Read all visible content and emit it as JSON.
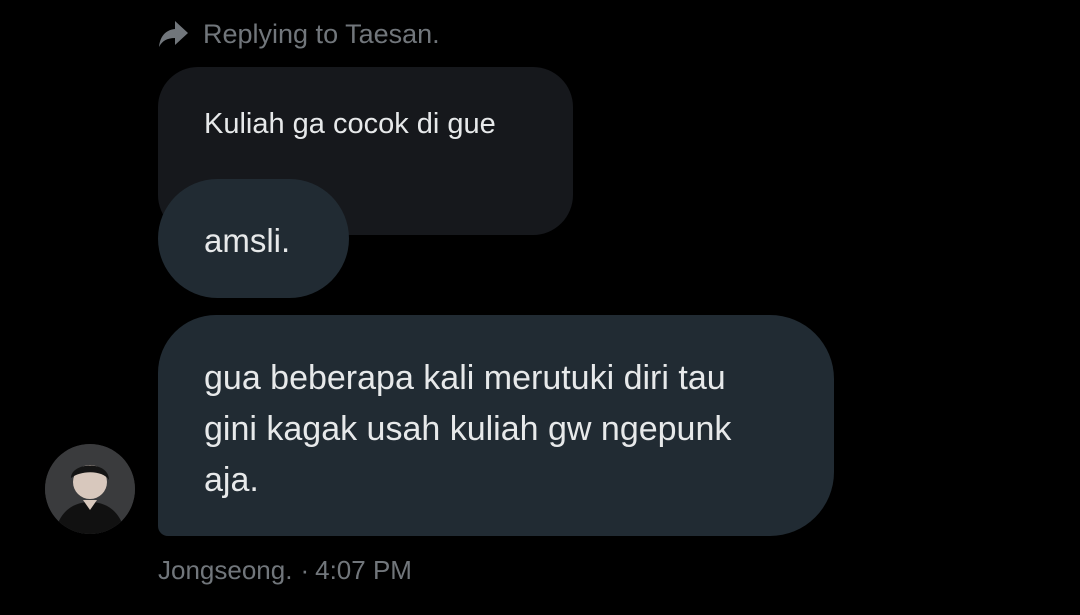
{
  "reply_context": {
    "icon": "reply-arrow-icon",
    "text": "Replying to Taesan."
  },
  "quoted_message": {
    "text": "Kuliah ga cocok di gue"
  },
  "messages": [
    {
      "text": "amsli."
    },
    {
      "lines": [
        "gua beberapa kali merutuki diri tau",
        "gini kagak usah kuliah gw ngepunk",
        "aja."
      ]
    }
  ],
  "sender": {
    "name": "Jongseong.",
    "separator": "·",
    "time": "4:07 PM",
    "avatar_icon": "user-avatar"
  },
  "colors": {
    "background": "#000000",
    "bubble": "#212b33",
    "quoted_bubble": "#16181c",
    "text": "#e7e9ea",
    "muted": "#71767b"
  }
}
